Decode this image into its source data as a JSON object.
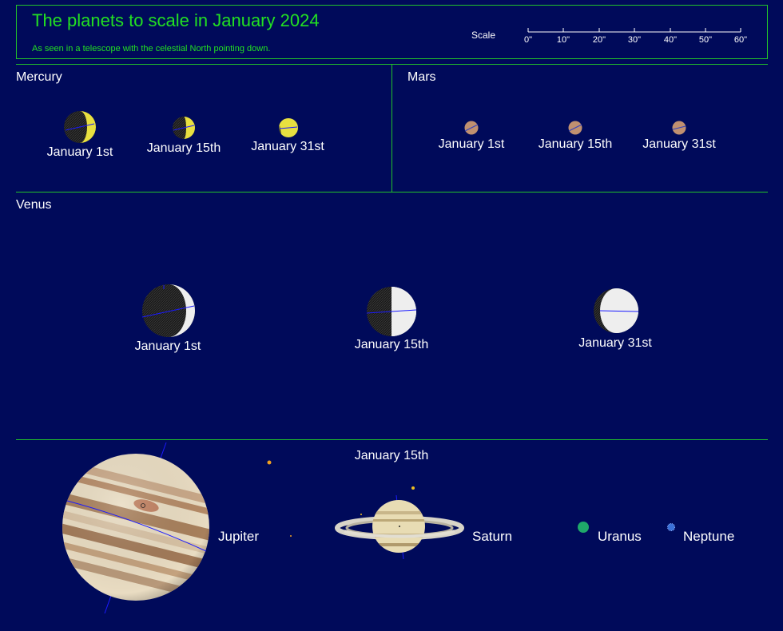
{
  "header": {
    "title": "The planets to scale in January 2024",
    "subtitle": "As seen in a telescope with the celestial North pointing down.",
    "scale_label": "Scale",
    "scale_ticks": [
      "0\"",
      "10\"",
      "20\"",
      "30\"",
      "40\"",
      "50\"",
      "60\""
    ]
  },
  "sections": {
    "mercury": {
      "title": "Mercury",
      "dates": [
        "January 1st",
        "January 15th",
        "January 31st"
      ]
    },
    "mars": {
      "title": "Mars",
      "dates": [
        "January 1st",
        "January 15th",
        "January 31st"
      ]
    },
    "venus": {
      "title": "Venus",
      "dates": [
        "January 1st",
        "January 15th",
        "January 31st"
      ]
    },
    "outer": {
      "date": "January 15th",
      "planets": [
        "Jupiter",
        "Saturn",
        "Uranus",
        "Neptune"
      ]
    }
  },
  "colors": {
    "background": "#000a5a",
    "frame": "#22c22a",
    "title": "#22e022",
    "mercury": "#e8e040",
    "mars": "#c09070",
    "venus": "#eeeeee",
    "uranus": "#1fa86a",
    "neptune": "#3a70d8",
    "axis": "#1a1aff"
  },
  "icons": [
    "mercury-disc",
    "mars-disc",
    "venus-disc",
    "jupiter-disc",
    "saturn-disc",
    "uranus-disc",
    "neptune-disc"
  ]
}
